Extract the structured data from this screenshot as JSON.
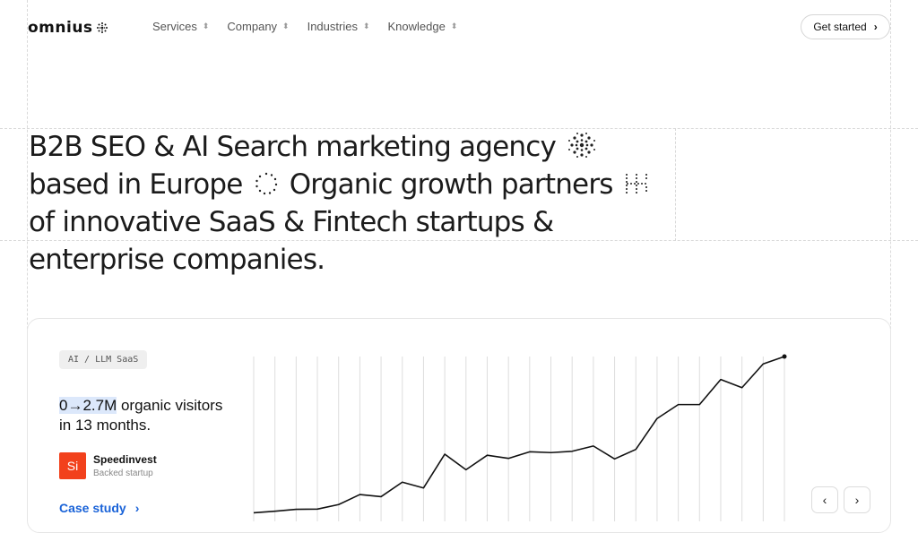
{
  "nav": {
    "logo_text": "omnius",
    "items": [
      {
        "label": "Services"
      },
      {
        "label": "Company"
      },
      {
        "label": "Industries"
      },
      {
        "label": "Knowledge"
      }
    ],
    "cta_label": "Get started"
  },
  "hero": {
    "part1": "B2B SEO & AI Search marketing agency",
    "part2": "based in Europe",
    "part3": "Organic growth partners",
    "part4": "of innovative SaaS & Fintech startups & enterprise companies."
  },
  "case": {
    "tag": "AI / LLM SaaS",
    "stat_highlight": "0→2.7M",
    "stat_rest": " organic visitors in 13 months.",
    "company_logo_text": "Si",
    "company_name": "Speedinvest",
    "company_subtitle": "Backed startup",
    "link_label": "Case study",
    "link_icon": "chevron-right-icon"
  },
  "chart_data": {
    "type": "line",
    "title": "",
    "xlabel": "",
    "ylabel": "",
    "grid": "vertical",
    "series": [
      {
        "values": [
          0.2,
          0.8,
          1.5,
          1.6,
          3.3,
          7.1,
          6.3,
          11.8,
          9.6,
          22.4,
          16.5,
          22.0,
          20.8,
          23.3,
          23.0,
          23.5,
          25.5,
          20.6,
          24.2,
          35.9,
          41.2,
          41.2,
          50.7,
          47.6,
          56.6,
          59.4
        ]
      }
    ],
    "accent": "#111111",
    "gridline_color": "#dddddd"
  },
  "pager": {
    "prev_icon": "chevron-left-icon",
    "next_icon": "chevron-right-icon"
  }
}
